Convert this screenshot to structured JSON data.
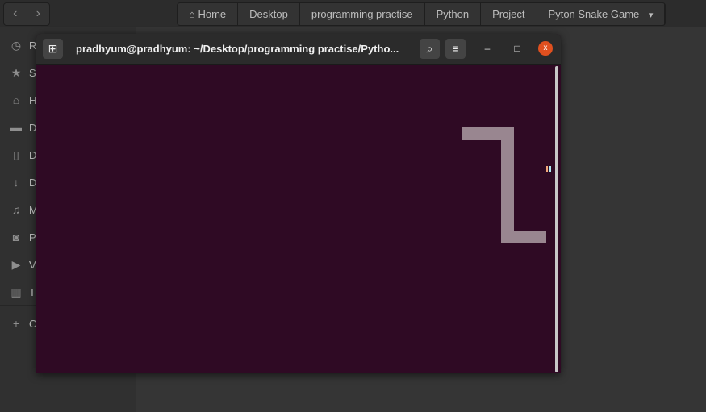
{
  "filemanager": {
    "nav": {
      "back": "‹",
      "forward": "›"
    },
    "breadcrumbs": [
      {
        "label": "Home",
        "icon": "home-icon"
      },
      {
        "label": "Desktop"
      },
      {
        "label": "programming practise"
      },
      {
        "label": "Python"
      },
      {
        "label": "Project"
      },
      {
        "label": "Pyton Snake Game",
        "dropdown": "▾"
      }
    ],
    "sidebar": [
      {
        "label": "R",
        "icon": "clock-icon",
        "glyph": "◷"
      },
      {
        "label": "St",
        "icon": "star-icon",
        "glyph": "★"
      },
      {
        "label": "H",
        "icon": "home-icon",
        "glyph": "⌂"
      },
      {
        "label": "D",
        "icon": "folder-icon",
        "glyph": "▬"
      },
      {
        "label": "D",
        "icon": "document-icon",
        "glyph": "▯"
      },
      {
        "label": "D",
        "icon": "download-icon",
        "glyph": "↓"
      },
      {
        "label": "M",
        "icon": "music-icon",
        "glyph": "♫"
      },
      {
        "label": "Pi",
        "icon": "camera-icon",
        "glyph": "◙"
      },
      {
        "label": "V",
        "icon": "video-icon",
        "glyph": "▶"
      },
      {
        "label": "Tr",
        "icon": "trash-icon",
        "glyph": "▥"
      },
      {
        "label": "O",
        "icon": "plus-icon",
        "glyph": "+"
      }
    ]
  },
  "terminal": {
    "title": "pradhyum@pradhyum: ~/Desktop/programming practise/Pytho...",
    "new_tab": "⊞",
    "search": "🔍",
    "menu": "≡",
    "minimize": "–",
    "maximize": "□",
    "close": "x",
    "colors": {
      "background": "#2f0a24",
      "snake": "#998690",
      "close": "#e0501f"
    }
  },
  "game": {
    "grid": {
      "cols": 81,
      "rows": 48
    },
    "snake": [
      {
        "x": 66,
        "y": 13
      },
      {
        "x": 72,
        "y": 13
      },
      {
        "x": 72,
        "y": 29
      },
      {
        "x": 77,
        "y": 29
      }
    ],
    "food": {
      "x": 79,
      "y": 16
    }
  }
}
